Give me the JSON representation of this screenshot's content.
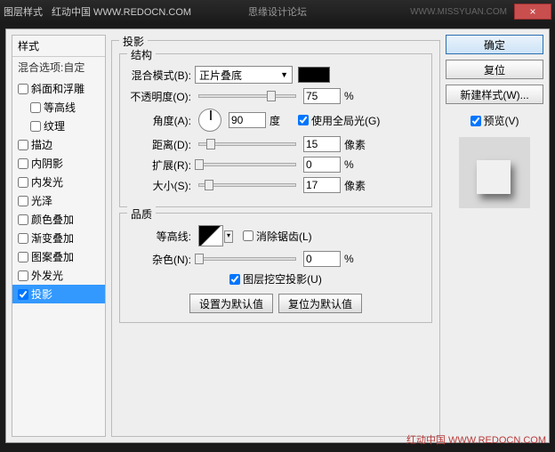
{
  "titlebar": {
    "title": "图层样式",
    "watermark1": "红动中国 WWW.REDOCN.COM",
    "center": "思缘设计论坛",
    "watermark2": "WWW.MISSYUAN.COM",
    "close": "×"
  },
  "sidebar": {
    "header": "样式",
    "sub": "混合选项:自定",
    "items": [
      {
        "label": "斜面和浮雕",
        "checked": false,
        "indent": false
      },
      {
        "label": "等高线",
        "checked": false,
        "indent": true
      },
      {
        "label": "纹理",
        "checked": false,
        "indent": true
      },
      {
        "label": "描边",
        "checked": false,
        "indent": false
      },
      {
        "label": "内阴影",
        "checked": false,
        "indent": false
      },
      {
        "label": "内发光",
        "checked": false,
        "indent": false
      },
      {
        "label": "光泽",
        "checked": false,
        "indent": false
      },
      {
        "label": "颜色叠加",
        "checked": false,
        "indent": false
      },
      {
        "label": "渐变叠加",
        "checked": false,
        "indent": false
      },
      {
        "label": "图案叠加",
        "checked": false,
        "indent": false
      },
      {
        "label": "外发光",
        "checked": false,
        "indent": false
      },
      {
        "label": "投影",
        "checked": true,
        "indent": false,
        "selected": true
      }
    ]
  },
  "main": {
    "title": "投影",
    "struct": {
      "title": "结构",
      "blend": {
        "label": "混合模式(B):",
        "value": "正片叠底",
        "color": "#000000"
      },
      "opacity": {
        "label": "不透明度(O):",
        "value": "75",
        "unit": "%",
        "pos": 75
      },
      "angle": {
        "label": "角度(A):",
        "value": "90",
        "unit": "度",
        "global_label": "使用全局光(G)",
        "global_checked": true
      },
      "distance": {
        "label": "距离(D):",
        "value": "15",
        "unit": "像素",
        "pos": 12
      },
      "spread": {
        "label": "扩展(R):",
        "value": "0",
        "unit": "%",
        "pos": 0
      },
      "size": {
        "label": "大小(S):",
        "value": "17",
        "unit": "像素",
        "pos": 10
      }
    },
    "quality": {
      "title": "品质",
      "contour": {
        "label": "等高线:",
        "anti_label": "消除锯齿(L)",
        "anti_checked": false
      },
      "noise": {
        "label": "杂色(N):",
        "value": "0",
        "unit": "%",
        "pos": 0
      },
      "knockout": {
        "label": "图层挖空投影(U)",
        "checked": true
      }
    },
    "buttons": {
      "default": "设置为默认值",
      "reset": "复位为默认值"
    }
  },
  "right": {
    "ok": "确定",
    "cancel": "复位",
    "newstyle": "新建样式(W)...",
    "preview": {
      "label": "预览(V)",
      "checked": true
    }
  },
  "footer": {
    "wm": "红动中国 WWW.REDOCN.COM"
  }
}
